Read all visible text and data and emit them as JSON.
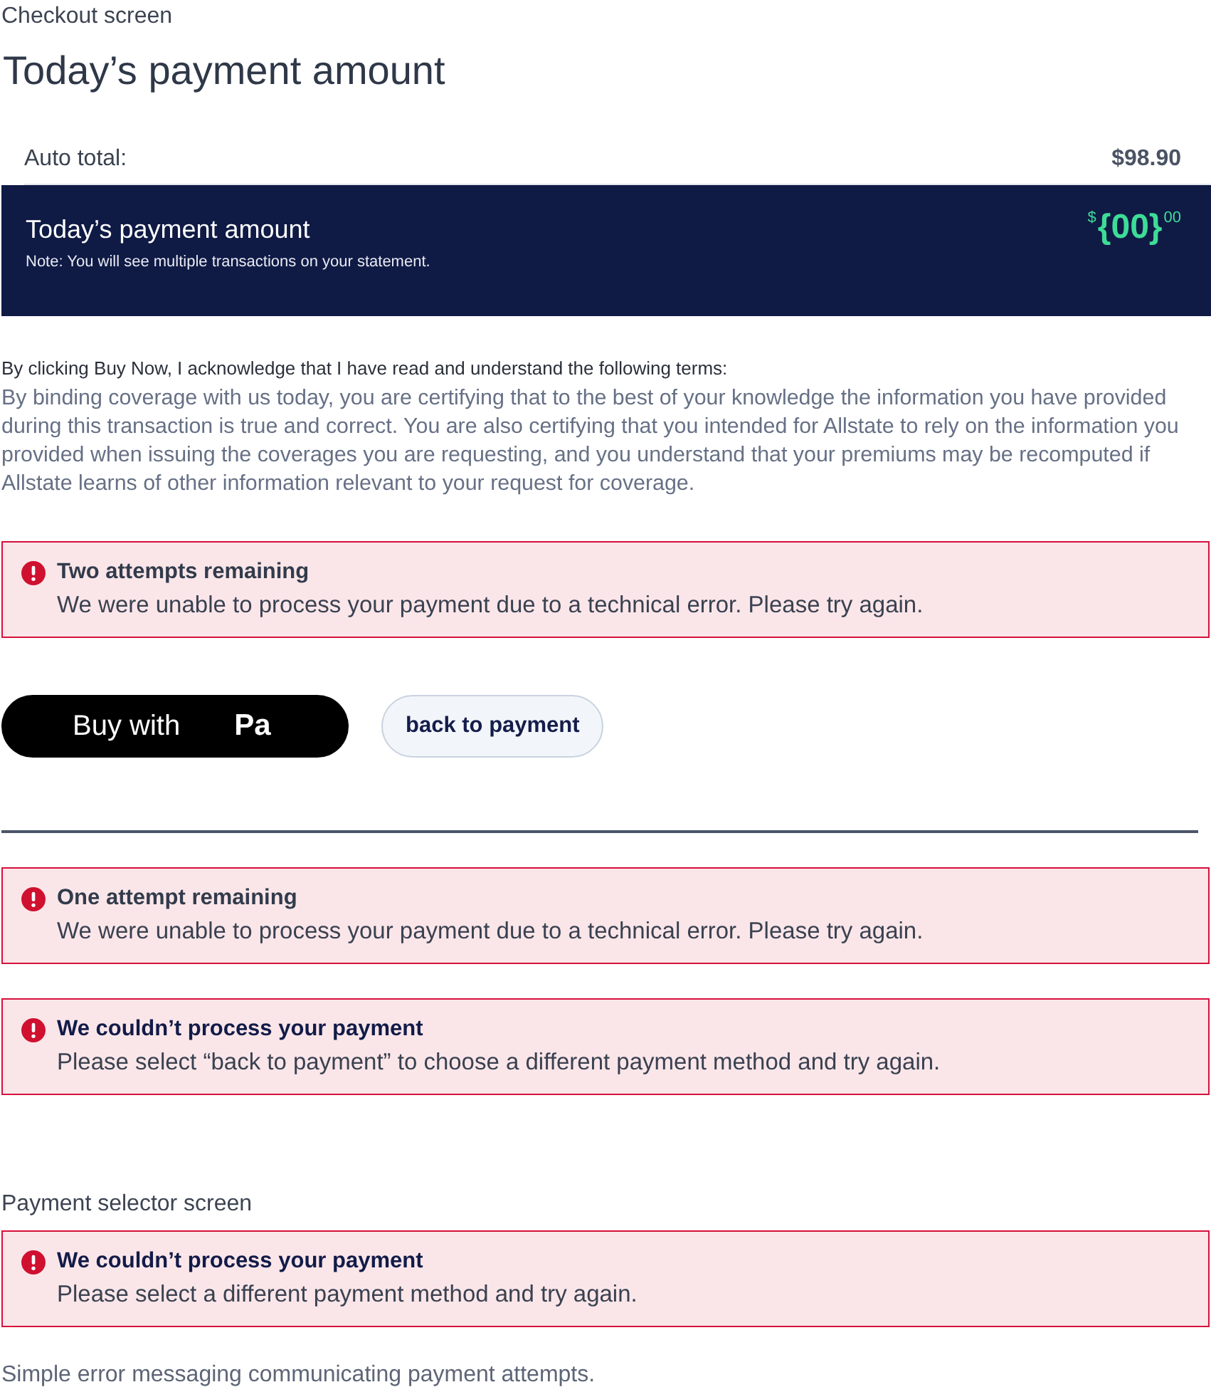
{
  "checkout_section": {
    "label": "Checkout screen",
    "heading": "Today’s payment amount",
    "summary": {
      "label": "Auto total:",
      "value": "$98.90"
    },
    "payment_panel": {
      "title": "Today’s payment amount",
      "note": "Note: You will see multiple transactions on your statement.",
      "amount": {
        "currency": "$",
        "whole": "{00}",
        "cents": "00"
      }
    },
    "terms": {
      "heading": "By clicking Buy Now, I acknowledge that I have read and understand the following terms:",
      "body": "By binding coverage with us today, you are certifying that to the best of your knowledge the information you have provided during this transaction is true and correct. You are also certifying that you intended for Allstate to rely on the information you provided when issuing the coverages you are requesting, and you understand that your premiums may be recomputed if Allstate learns of other information relevant to your request for coverage."
    },
    "alerts": [
      {
        "kind": "attempts",
        "title": "Two attempts remaining",
        "message": "We were unable to process your payment due to a technical error. Please try again."
      }
    ],
    "buttons": [
      {
        "kind": "pay",
        "label": "Buy with",
        "brand": "Pa"
      },
      {
        "kind": "secondary",
        "label": "back to payment"
      }
    ]
  },
  "checkout_variants": {
    "alerts": [
      {
        "kind": "attempts",
        "title": "One attempt remaining",
        "message": "We were unable to process your payment due to a technical error. Please try again."
      },
      {
        "kind": "blocked",
        "title": "We couldn’t process your payment",
        "message": "Please select “back to payment” to choose a different payment method and try again."
      }
    ]
  },
  "payment_selector_section": {
    "label": "Payment selector screen",
    "alerts": [
      {
        "kind": "blocked",
        "title": "We couldn’t process your payment",
        "message": "Please select a different payment method and try again."
      }
    ]
  },
  "caption": "Simple error messaging communicating payment attempts."
}
